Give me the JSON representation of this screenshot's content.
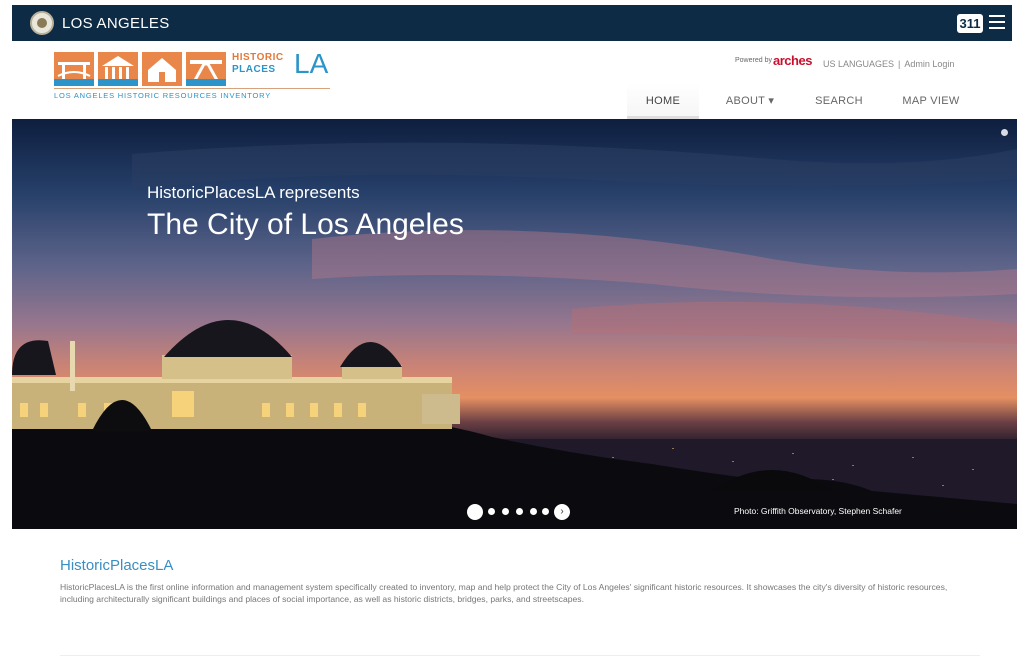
{
  "citybar": {
    "city_name": "LOS ANGELES",
    "btn_311": "311",
    "menu_icon": "hamburger-menu-icon",
    "seal_icon": "city-seal-icon",
    "bg_color": "#0d2b44"
  },
  "logo": {
    "historic": "HISTORIC",
    "places": "PLACES",
    "la": "LA",
    "tagline": "LOS ANGELES HISTORIC RESOURCES INVENTORY",
    "orange": "#e9874b",
    "blue": "#2c94c8"
  },
  "header": {
    "powered_by": "Powered by",
    "arches": "arches",
    "languages": "US LANGUAGES",
    "login": "Admin Login"
  },
  "nav": {
    "items": [
      {
        "label": "HOME",
        "active": true
      },
      {
        "label": "ABOUT ▾"
      },
      {
        "label": "SEARCH"
      },
      {
        "label": "MAP VIEW"
      }
    ]
  },
  "hero": {
    "kicker": "HistoricPlacesLA represents",
    "title": "The City of Los Angeles",
    "photo_credit": "Photo: Griffith Observatory, Stephen Schafer",
    "carousel": {
      "slide_count": 5,
      "active_index": 0
    }
  },
  "intro": {
    "title": "HistoricPlacesLA",
    "text": "HistoricPlacesLA is the first online information and management system specifically created to inventory, map and help protect the City of Los Angeles' significant historic resources. It showcases the city's diversity of historic resources, including architecturally significant buildings and places of social importance, as well as historic districts, bridges, parks, and streetscapes."
  }
}
